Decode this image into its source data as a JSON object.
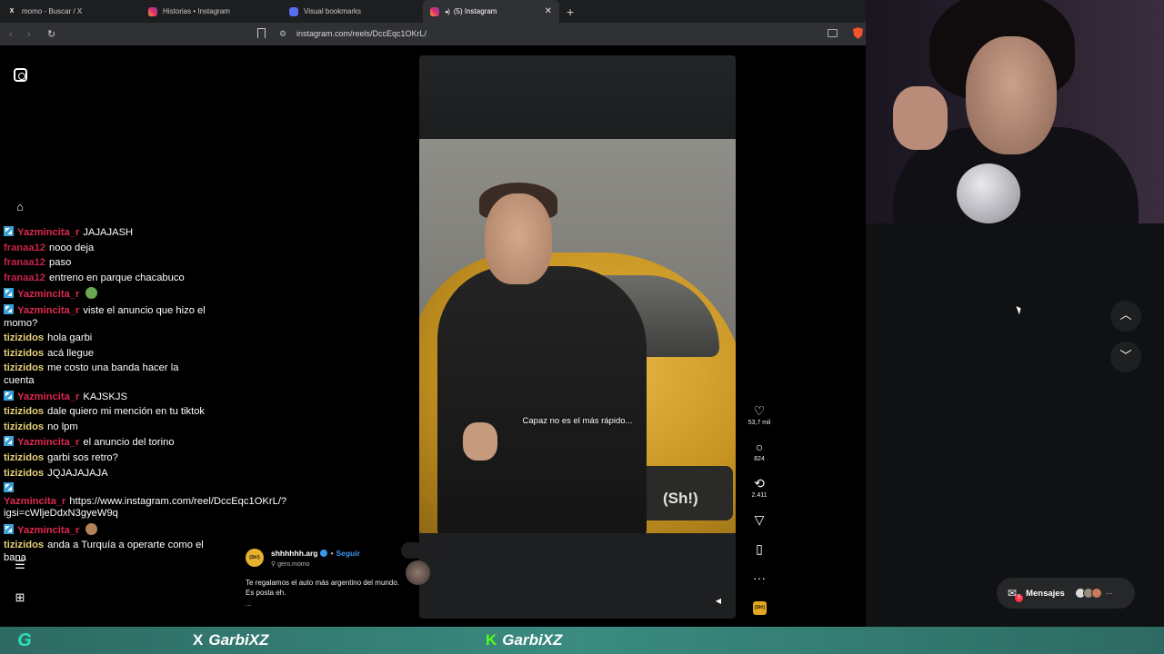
{
  "browser": {
    "tabs": [
      {
        "icon": "x-logo-icon",
        "label": "momo - Buscar / X",
        "active": false
      },
      {
        "icon": "instagram-icon",
        "label": "Historias • Instagram",
        "active": false
      },
      {
        "icon": "bookmarks-icon",
        "label": "Visual bookmarks",
        "active": false
      },
      {
        "icon": "instagram-icon",
        "label": "(5) Instagram",
        "active": true
      }
    ],
    "new_tab": "+",
    "close": "✕",
    "url": "instagram.com/reels/DccEqc1OKrL/"
  },
  "chat": [
    {
      "user": "Yazmincita_r",
      "color": "#e0284f",
      "badge": true,
      "text": "JAJAJASH"
    },
    {
      "user": "franaa12",
      "color": "#c8224a",
      "badge": false,
      "text": "nooo deja"
    },
    {
      "user": "franaa12",
      "color": "#c8224a",
      "badge": false,
      "text": "paso"
    },
    {
      "user": "franaa12",
      "color": "#c8224a",
      "badge": false,
      "text": "entreno en parque chacabuco"
    },
    {
      "user": "Yazmincita_r",
      "color": "#e0284f",
      "badge": true,
      "text": "",
      "emote": "#6aa84f"
    },
    {
      "user": "Yazmincita_r",
      "color": "#e0284f",
      "badge": true,
      "text": "viste el anuncio que hizo el momo?"
    },
    {
      "user": "tizizidos",
      "color": "#e8d27a",
      "badge": false,
      "text": "hola garbi"
    },
    {
      "user": "tizizidos",
      "color": "#e8d27a",
      "badge": false,
      "text": "acá llegue"
    },
    {
      "user": "tizizidos",
      "color": "#e8d27a",
      "badge": false,
      "text": "me costo una banda hacer la cuenta"
    },
    {
      "user": "Yazmincita_r",
      "color": "#e0284f",
      "badge": true,
      "text": "KAJSKJS"
    },
    {
      "user": "tizizidos",
      "color": "#e8d27a",
      "badge": false,
      "text": "dale quiero mi mención en tu tiktok"
    },
    {
      "user": "tizizidos",
      "color": "#e8d27a",
      "badge": false,
      "text": "no lpm"
    },
    {
      "user": "Yazmincita_r",
      "color": "#e0284f",
      "badge": true,
      "text": "el anuncio del torino"
    },
    {
      "user": "tizizidos",
      "color": "#e8d27a",
      "badge": false,
      "text": "garbi sos retro?"
    },
    {
      "user": "tizizidos",
      "color": "#e8d27a",
      "badge": false,
      "text": "JQJAJAJAJA"
    },
    {
      "user": "Yazmincita_r",
      "color": "#e0284f",
      "badge": true,
      "text": "https://www.instagram.com/reel/DccEqc1OKrL/?igsi=cWljeDdxN3gyeW9q"
    },
    {
      "user": "Yazmincita_r",
      "color": "#e0284f",
      "badge": true,
      "text": "",
      "emote": "#b5835a"
    },
    {
      "user": "tizizidos",
      "color": "#e8d27a",
      "badge": false,
      "text": "anda a Turquía a operarte como el bana"
    }
  ],
  "reel": {
    "caption": "Capaz no es el más rápido...",
    "brand": "(Sh!)",
    "likes": "53,7 mil",
    "comments": "824",
    "reposts": "2.411",
    "author": "shhhhhh.arg",
    "follow": "Seguir",
    "collab": "gero.momo",
    "description": "Te regalamos el auto más argentino del mundo. Es posta eh.",
    "more": "..."
  },
  "messages": {
    "label": "Mensajes",
    "count": "5"
  },
  "stream": {
    "twitter": "GarbiXZ",
    "kick": "GarbiXZ"
  }
}
